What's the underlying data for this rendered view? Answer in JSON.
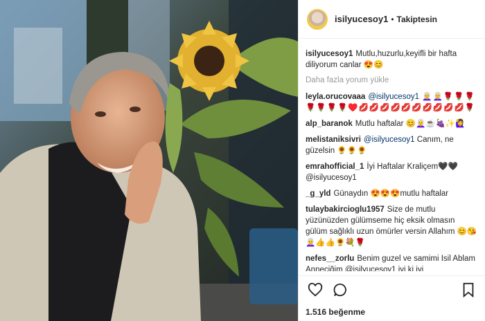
{
  "profile": {
    "username": "isilyucesoy1",
    "separator": "•",
    "follow_status": "Takiptesin"
  },
  "caption": {
    "user": "isilyucesoy1",
    "text": "Mutlu,huzurlu,keyifli bir hafta diliyorum canlar 😍😊"
  },
  "load_more": "Daha fazla yorum yükle",
  "comments": [
    {
      "user": "leyla.orucovaaa",
      "mention": "@isilyucesoy1",
      "text": " 👩‍🦳👩‍🦳🌹🌹🌹🌹🌹🌹🌹♥️💋💋💋💋💋💋💋💋💋💋🌹"
    },
    {
      "user": "alp_baranok",
      "mention": "",
      "text": "Mutlu haftalar 😊👩‍🦳☕🍇✨🙋‍♀️"
    },
    {
      "user": "melistaniksivri",
      "mention": "@isilyucesoy1",
      "text": " Canım, ne güzelsin 🌻🌻🌻"
    },
    {
      "user": "emrahofficial_1",
      "mention": "",
      "text": "İyi Haftalar Kraliçem🖤🖤 @isilyucesoy1"
    },
    {
      "user": "_g_yld",
      "mention": "",
      "text": "Günaydın 😍😍😍mutlu haftalar"
    },
    {
      "user": "tulaybakircioglu1957",
      "mention": "",
      "text": "Size de mutlu yüzünüzden gülümseme hiç eksik olmasın gülüm sağlıklı uzun ömürler versin Allahım 😊😘👩‍🦳👍👍🌻💐🌹"
    },
    {
      "user": "nefes__zorlu",
      "mention": "",
      "text": "Benim guzel ve samimi Isil Ablam Anneciğim @isilyucesoy1 iyi ki iyi"
    }
  ],
  "likes": "1.516 beğenme",
  "colors": {
    "accent": "#f2c94c",
    "mention": "#003569",
    "muted": "#999999"
  }
}
